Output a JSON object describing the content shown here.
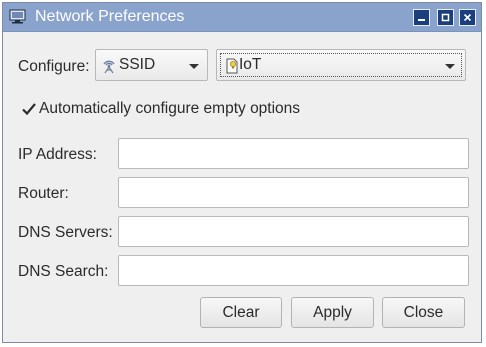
{
  "window": {
    "title": "Network Preferences",
    "title_icon": "network-settings-icon",
    "controls": [
      "minimize-icon",
      "maximize-icon",
      "close-icon"
    ]
  },
  "configure": {
    "label": "Configure:",
    "type_select": {
      "value": "SSID",
      "icon": "wifi-ssid-icon"
    },
    "target_select": {
      "value": "IoT",
      "icon": "bulb-icon"
    }
  },
  "auto_option": {
    "label": "Automatically configure empty options",
    "checked": true
  },
  "fields": [
    {
      "label": "IP Address:",
      "value": ""
    },
    {
      "label": "Router:",
      "value": ""
    },
    {
      "label": "DNS Servers:",
      "value": ""
    },
    {
      "label": "DNS Search:",
      "value": ""
    }
  ],
  "buttons": {
    "clear": "Clear",
    "apply": "Apply",
    "close": "Close"
  },
  "colors": {
    "titlebar": "#8aa3cc",
    "window_bg": "#efefef",
    "control_button": "#1b3f7c"
  }
}
